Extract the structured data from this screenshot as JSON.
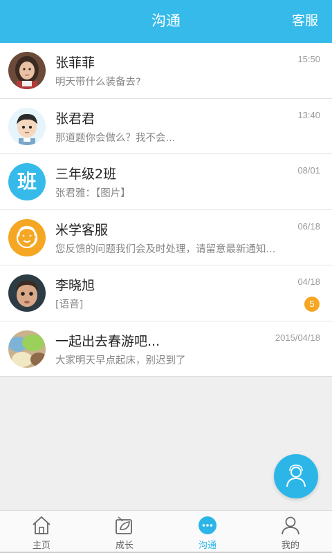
{
  "header": {
    "title": "沟通",
    "service_label": "客服"
  },
  "conversations": [
    {
      "name": "张菲菲",
      "message": "明天带什么装备去?",
      "time": "15:50",
      "avatar": "girl-photo"
    },
    {
      "name": "张君君",
      "message": "那道题你会做么？我不会...",
      "time": "13:40",
      "avatar": "boy-cartoon"
    },
    {
      "name": "三年级2班",
      "message": "张君雅：【图片】",
      "time": "08/01",
      "avatar": "class-group",
      "avatar_text": "班"
    },
    {
      "name": "米学客服",
      "message": "您反馈的问题我们会及时处理，请留意最新通知...",
      "time": "06/18",
      "avatar": "service-agent"
    },
    {
      "name": "李晓旭",
      "message": "[语音]",
      "time": "04/18",
      "avatar": "child-photo",
      "unread": "5"
    },
    {
      "name": "一起出去春游吧...",
      "message": "大家明天早点起床，别迟到了",
      "time": "2015/04/18",
      "avatar": "macaron-photo"
    }
  ],
  "tabs": [
    {
      "label": "主页",
      "icon": "home-icon"
    },
    {
      "label": "成长",
      "icon": "leaf-icon"
    },
    {
      "label": "沟通",
      "icon": "chat-icon",
      "active": true
    },
    {
      "label": "我的",
      "icon": "person-icon"
    }
  ],
  "colors": {
    "accent": "#35baea",
    "badge": "#f5a623",
    "service_avatar": "#f5a623"
  }
}
